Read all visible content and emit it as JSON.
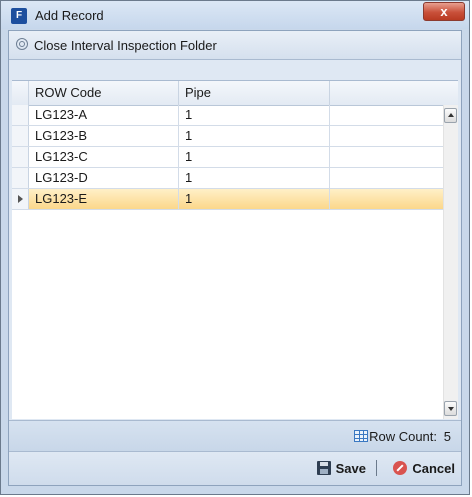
{
  "window": {
    "title": "Add Record",
    "close_glyph": "x"
  },
  "group": {
    "title": "Close Interval Inspection Folder"
  },
  "grid": {
    "columns": [
      "ROW Code",
      "Pipe"
    ],
    "rows": [
      {
        "row_code": "LG123-A",
        "pipe": "1"
      },
      {
        "row_code": "LG123-B",
        "pipe": "1"
      },
      {
        "row_code": "LG123-C",
        "pipe": "1"
      },
      {
        "row_code": "LG123-D",
        "pipe": "1"
      },
      {
        "row_code": "LG123-E",
        "pipe": "1",
        "selected": true
      }
    ]
  },
  "status": {
    "row_count_label": "Row Count:",
    "row_count_value": "5"
  },
  "footer": {
    "save_label": "Save",
    "separator": "|",
    "cancel_label": "Cancel"
  },
  "icons": {
    "app": "app-icon",
    "collapse": "collapse-circle-icon",
    "table": "table-icon",
    "save": "floppy-disk-icon",
    "cancel": "no-entry-icon",
    "row_pointer": "triangle-right-icon"
  },
  "colors": {
    "selected_row": "#fbd78a",
    "frame": "#c9d8ea",
    "close_button": "#c9503a"
  }
}
